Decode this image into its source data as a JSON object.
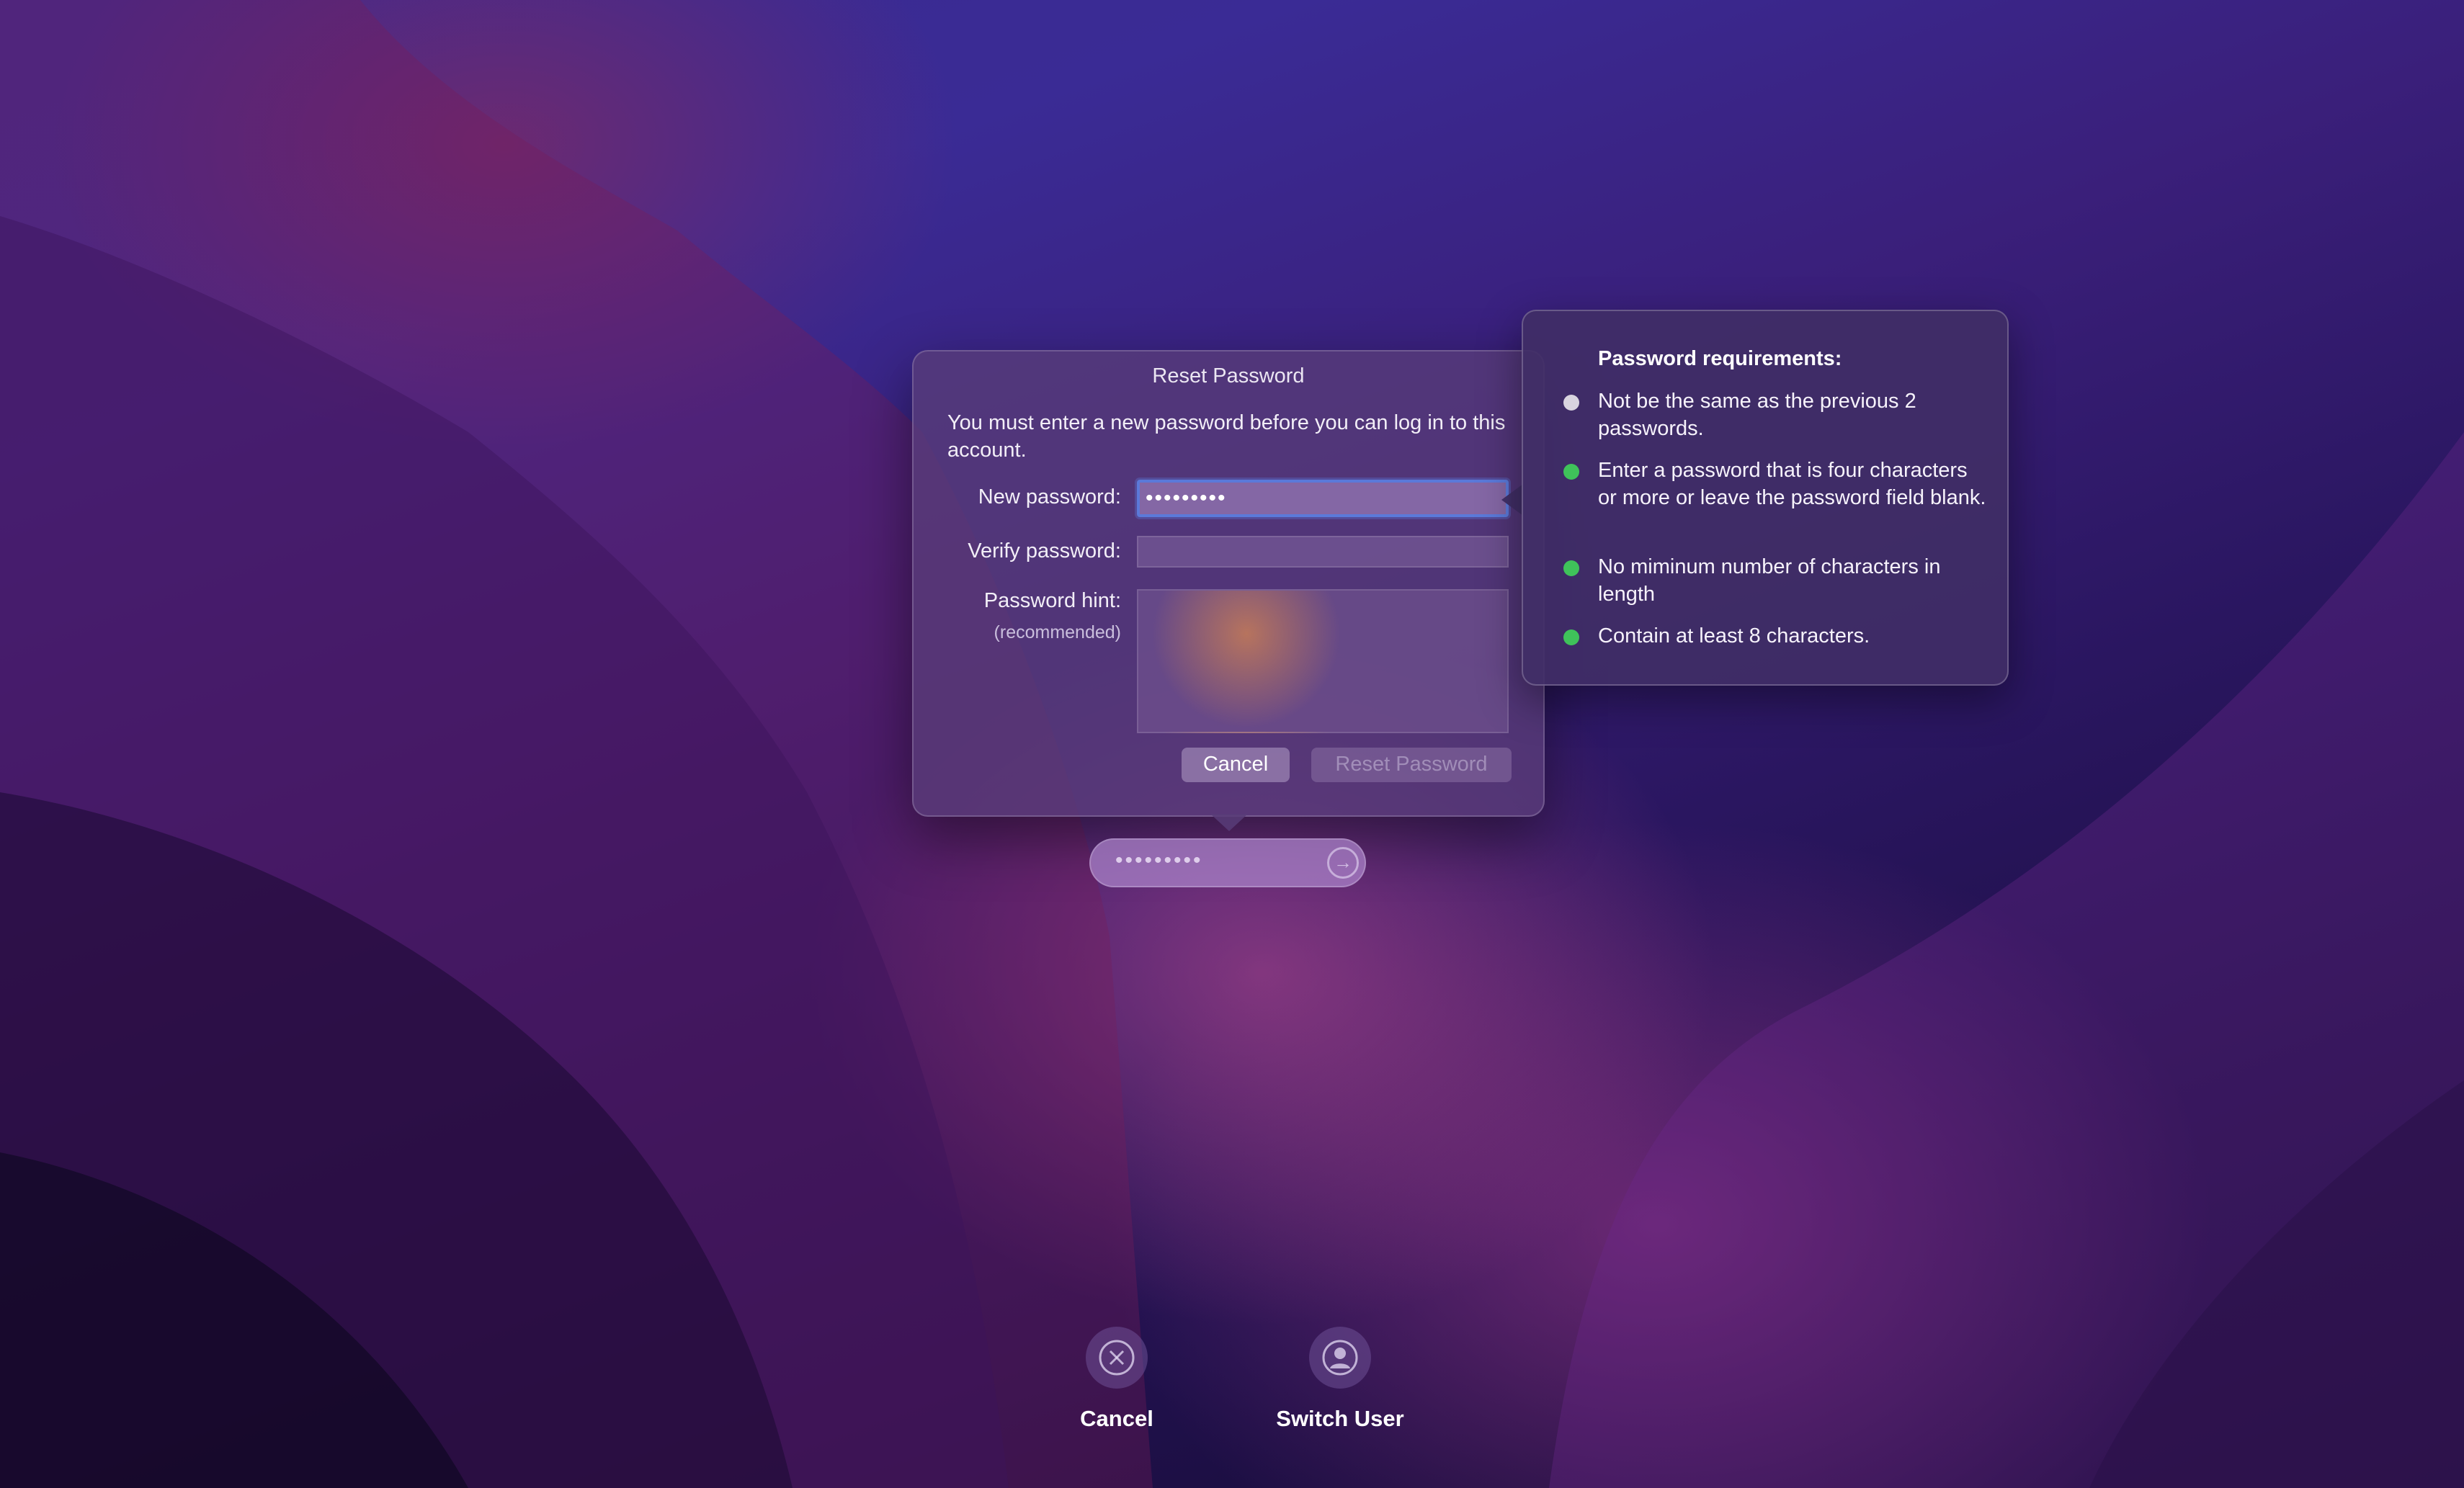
{
  "reset_dialog": {
    "title": "Reset Password",
    "message": "You must enter a new password before you can log in to this account.",
    "new_password_label": "New password:",
    "new_password_value": "•••••••••",
    "verify_password_label": "Verify password:",
    "verify_password_value": "",
    "hint_label": "Password hint:",
    "hint_sublabel": "(recommended)",
    "hint_value": "",
    "cancel_label": "Cancel",
    "reset_label": "Reset Password"
  },
  "requirements": {
    "title": "Password requirements:",
    "items": [
      {
        "text": "Not be the same as the previous 2 passwords.",
        "status": "unmet",
        "color": "#d9d4df"
      },
      {
        "text": "Enter a password that is four characters or more or leave the password field blank.",
        "status": "met",
        "color": "#3fc25a"
      },
      {
        "text": "No miminum number of characters in length",
        "status": "met",
        "color": "#3fc25a"
      },
      {
        "text": "Contain at least 8 characters.",
        "status": "met",
        "color": "#3fc25a"
      }
    ]
  },
  "login": {
    "password_value": "•••••••••",
    "submit_icon": "arrow-right-circle-icon"
  },
  "bottom_actions": [
    {
      "label": "Cancel",
      "icon": "close-circle-icon"
    },
    {
      "label": "Switch User",
      "icon": "user-circle-icon"
    }
  ],
  "colors": {
    "focus_ring": "#5b79d9",
    "met": "#3fc25a",
    "unmet": "#d9d4df"
  }
}
